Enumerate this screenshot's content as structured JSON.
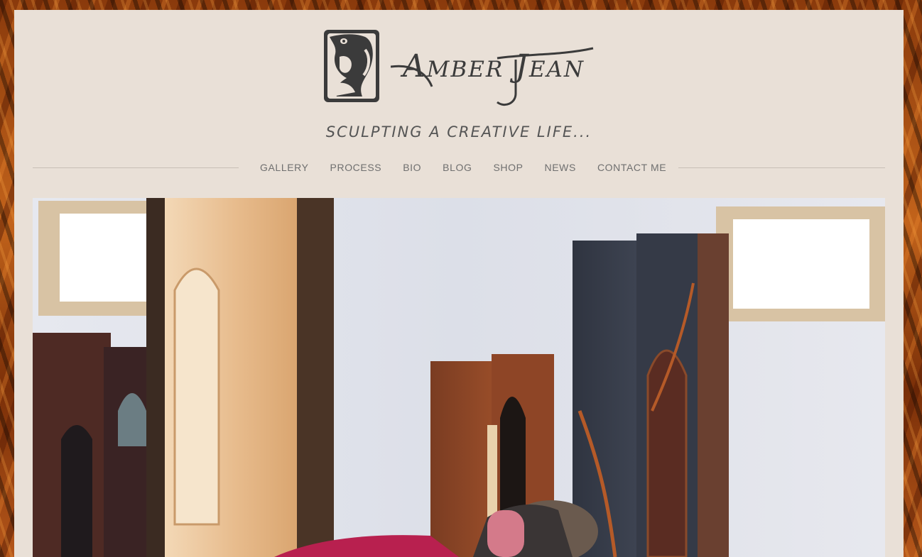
{
  "site": {
    "logo_name": "Amber Jean",
    "tagline": "SCULPTING A CREATIVE LIFE..."
  },
  "nav": {
    "items": [
      {
        "label": "GALLERY"
      },
      {
        "label": "PROCESS"
      },
      {
        "label": "BIO"
      },
      {
        "label": "BLOG"
      },
      {
        "label": "SHOP"
      },
      {
        "label": "NEWS"
      },
      {
        "label": "CONTACT ME"
      }
    ]
  },
  "colors": {
    "page_bg": "#e9e0d7",
    "nav_text": "#6f6f6f",
    "logo_ink": "#3b3b3b"
  },
  "hero": {
    "icon": "studio-photo-image"
  }
}
